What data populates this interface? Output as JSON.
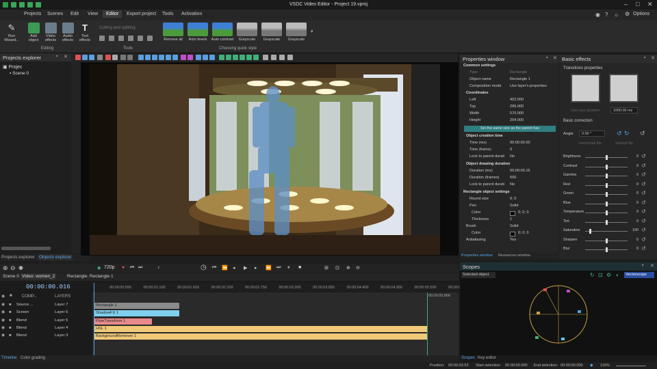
{
  "app": {
    "title": "VSDC Video Editor - Project 19.vproj",
    "options_label": "Options"
  },
  "menu": [
    "Projects",
    "Scenes",
    "Edit",
    "View",
    "Editor",
    "Export project",
    "Tools",
    "Activation"
  ],
  "ribbon": {
    "run_wizard": "Run Wizard...",
    "add_object": "Add object",
    "video_effects": "Video effects",
    "audio_effects": "Audio effects",
    "text_effects": "Text effects",
    "cutting_splitting": "Cutting and splitting",
    "editing_group": "Editing",
    "tools_group": "Tools",
    "quick_style_group": "Choosing quick style",
    "quick_styles": [
      "Remove all",
      "Auto levels",
      "Auto contrast",
      "Grayscale",
      "Grayscale",
      "Grayscale"
    ]
  },
  "projects_explorer": {
    "title": "Projects explorer",
    "root": "Projec",
    "scene": "Scene 0",
    "tabs": [
      "Projects explorer",
      "Objects explorer"
    ]
  },
  "properties": {
    "title": "Properties window",
    "common_settings": "Common settings",
    "type_label": "Type",
    "type_value": "Rectangle",
    "object_name_label": "Object name",
    "object_name_value": "Rectangle 1",
    "composition_mode_label": "Composition mode",
    "composition_mode_value": "Use layer's properties",
    "coordinates": "Coordinates",
    "left_label": "Left",
    "left_value": "402.000",
    "top_label": "Top",
    "top_value": "289.000",
    "width_label": "Width",
    "width_value": "570.000",
    "height_label": "Height",
    "height_value": "264.000",
    "same_size_btn": "Set the same size as the parent has",
    "creation_time": "Object creation time",
    "time_ms_label": "Time (ms)",
    "time_ms_value": "00:00:00.00",
    "time_frame_label": "Time (frame)",
    "time_frame_value": "0",
    "lock_parent_label": "Lock to parent durati",
    "lock_parent_value": "No",
    "drawing_duration": "Object drawing duration",
    "duration_ms_label": "Duration (ms)",
    "duration_ms_value": "00:00:09.16",
    "duration_frames_label": "Duration (frames)",
    "duration_frames_value": "556",
    "lock_parent2_label": "Lock to parent durati",
    "lock_parent2_value": "No",
    "rect_settings": "Rectangle object settings",
    "round_size_label": "Round size",
    "round_size_value": "0; 0",
    "pen_label": "Pen",
    "pen_value": "Solid",
    "color_label": "Color",
    "color_value": "0; 0; 0",
    "thickness_label": "Thickness",
    "thickness_value": "1",
    "brush_label": "Brush",
    "brush_value": "Solid",
    "bcolor_label": "Color",
    "bcolor_value": "0; 0; 0",
    "antialiasing_label": "Antialiasing",
    "antialiasing_value": "Yes",
    "tabs": [
      "Properties window",
      "Resources window"
    ]
  },
  "effects": {
    "title": "Basic effects",
    "transitions": "Transitions properties",
    "use_max_duration": "Use max duration",
    "duration_value": "1000.00 ms",
    "basic_correction": "Basic correction",
    "angle_label": "Angle",
    "angle_value": "0.00 °",
    "horizontal_flip": "Horizontal flip",
    "vertical_flip": "Vertical flip",
    "adjustments": [
      {
        "label": "Brightness",
        "value": "0",
        "level": 0.5
      },
      {
        "label": "Contrast",
        "value": "0",
        "level": 0.5
      },
      {
        "label": "Gamma",
        "value": "0",
        "level": 0.5
      },
      {
        "label": "Red",
        "value": "0",
        "level": 0.5
      },
      {
        "label": "Green",
        "value": "0",
        "level": 0.5
      },
      {
        "label": "Blue",
        "value": "0",
        "level": 0.5
      },
      {
        "label": "Temperature",
        "value": "0",
        "level": 0.5
      },
      {
        "label": "Tint",
        "value": "0",
        "level": 0.5
      },
      {
        "label": "Saturation",
        "value": "100",
        "level": 0.1
      },
      {
        "label": "Sharpen",
        "value": "0",
        "level": 0.5
      },
      {
        "label": "Blur",
        "value": "0",
        "level": 0.5
      }
    ]
  },
  "playback": {
    "resolution": "720p"
  },
  "timeline": {
    "tabs": [
      "Scene 0",
      "Video: women_2",
      "Rectangle: Rectangle 1"
    ],
    "current_time": "00:00:00.016",
    "comp_label": "COMP...",
    "layers_label": "LAYERS",
    "ruler": [
      "00:00:00.550",
      "00:00:01.100",
      "00:00:01.650",
      "00:00:02.200",
      "00:00:02.750",
      "00:00:03.300",
      "00:00:03.850",
      "00:00:04.400",
      "00:00:04.950",
      "00:00:05.500",
      "00:00:06.050"
    ],
    "end_marker": "00:00:05.866",
    "tracks": [
      {
        "blend": "Source ...",
        "layer": "Layer 7",
        "clip": "Rectangle 1",
        "color": "#8a8a8a"
      },
      {
        "blend": "Screen",
        "layer": "Layer 6",
        "clip": "ShadowFX 1",
        "color": "#7fd0ee"
      },
      {
        "blend": "Blend",
        "layer": "Layer 5",
        "clip": "FlowTransform 1",
        "color": "#e8898a"
      },
      {
        "blend": "Blend",
        "layer": "Layer 4",
        "clip": "HSL 1",
        "color": "#f0c877"
      },
      {
        "blend": "Blend",
        "layer": "Layer 3",
        "clip": "BackgroundRemover 1",
        "color": "#f0c877"
      }
    ],
    "bottom_tabs": [
      "Timeline",
      "Color grading"
    ]
  },
  "scopes": {
    "title": "Scopes",
    "selected": "Selected object",
    "mode": "Vectorscope",
    "tabs": [
      "Scopes",
      "Key editor"
    ]
  },
  "status": {
    "position_label": "Position:",
    "position_value": "00:00:03.53",
    "start_label": "Start selection:",
    "start_value": "00:00:00.000",
    "end_label": "End selection:",
    "end_value": "00:00:00.000",
    "zoom": "116%"
  }
}
